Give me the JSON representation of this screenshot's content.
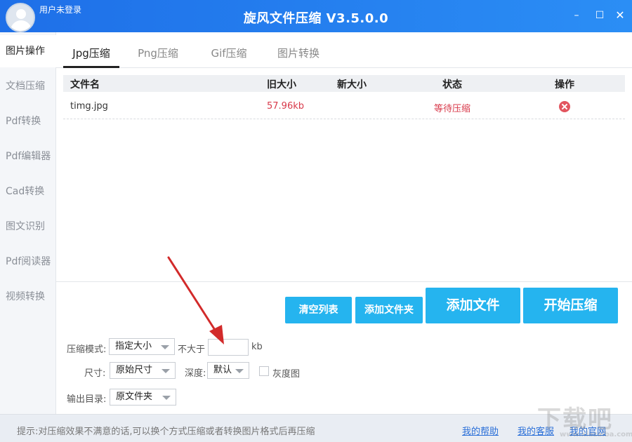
{
  "user": {
    "label": "用户未登录"
  },
  "app": {
    "title": "旋风文件压缩 V3.5.0.0"
  },
  "window": {
    "minimize": "–",
    "maximize": "☐",
    "close": "✕"
  },
  "sidebar": {
    "items": [
      {
        "label": "图片操作",
        "active": true
      },
      {
        "label": "文档压缩"
      },
      {
        "label": "Pdf转换"
      },
      {
        "label": "Pdf编辑器"
      },
      {
        "label": "Cad转换"
      },
      {
        "label": "图文识别"
      },
      {
        "label": "Pdf阅读器"
      },
      {
        "label": "视频转换"
      }
    ]
  },
  "tabs": [
    {
      "label": "Jpg压缩",
      "active": true
    },
    {
      "label": "Png压缩"
    },
    {
      "label": "Gif压缩"
    },
    {
      "label": "图片转换"
    }
  ],
  "table": {
    "headers": [
      "文件名",
      "旧大小",
      "新大小",
      "状态",
      "操作"
    ],
    "rows": [
      {
        "name": "timg.jpg",
        "old_size": "57.96kb",
        "new_size": "",
        "status": "等待压缩",
        "action_icon": "close-circle-icon"
      }
    ]
  },
  "actions": {
    "clear_list": "清空列表",
    "add_folder": "添加文件夹",
    "add_file": "添加文件",
    "start": "开始压缩"
  },
  "form": {
    "mode_label": "压缩模式:",
    "mode_value": "指定大小",
    "max_label": "不大于",
    "max_value": "",
    "unit": "kb",
    "size_label": "尺寸:",
    "size_value": "原始尺寸",
    "depth_label": "深度:",
    "depth_value": "默认",
    "grayscale_label": "灰度图",
    "grayscale_checked": false,
    "output_label": "输出目录:",
    "output_value": "原文件夹"
  },
  "footer": {
    "tip": "提示:对压缩效果不满意的话,可以换个方式压缩或者转换图片格式后再压缩",
    "links": [
      "我的帮助",
      "我的客服",
      "我的官网"
    ]
  },
  "watermark": {
    "text": "下载吧",
    "subtext": "www.xiazaiba.com"
  },
  "colors": {
    "titlebar": "#1e6fe8",
    "accent": "#25b4ef",
    "status_red": "#d8394a",
    "arrow": "#d22a2a"
  }
}
